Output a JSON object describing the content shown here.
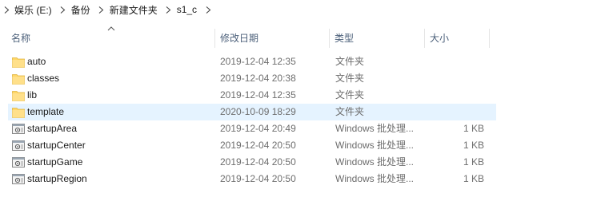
{
  "breadcrumb": [
    "娱乐 (E:)",
    "备份",
    "新建文件夹",
    "s1_c"
  ],
  "columns": {
    "name": "名称",
    "date": "修改日期",
    "type": "类型",
    "size": "大小"
  },
  "sort": {
    "column": "name",
    "direction": "ascending"
  },
  "files": [
    {
      "name": "auto",
      "date": "2019-12-04 12:35",
      "type": "文件夹",
      "size": "",
      "icon": "folder-icon"
    },
    {
      "name": "classes",
      "date": "2019-12-04 20:38",
      "type": "文件夹",
      "size": "",
      "icon": "folder-icon"
    },
    {
      "name": "lib",
      "date": "2019-12-04 12:35",
      "type": "文件夹",
      "size": "",
      "icon": "folder-icon"
    },
    {
      "name": "template",
      "date": "2020-10-09 18:29",
      "type": "文件夹",
      "size": "",
      "icon": "folder-icon",
      "selected": true
    },
    {
      "name": "startupArea",
      "date": "2019-12-04 20:49",
      "type": "Windows 批处理...",
      "size": "1 KB",
      "icon": "batch-file-icon"
    },
    {
      "name": "startupCenter",
      "date": "2019-12-04 20:50",
      "type": "Windows 批处理...",
      "size": "1 KB",
      "icon": "batch-file-icon"
    },
    {
      "name": "startupGame",
      "date": "2019-12-04 20:50",
      "type": "Windows 批处理...",
      "size": "1 KB",
      "icon": "batch-file-icon"
    },
    {
      "name": "startupRegion",
      "date": "2019-12-04 20:50",
      "type": "Windows 批处理...",
      "size": "1 KB",
      "icon": "batch-file-icon"
    }
  ],
  "colors": {
    "header_text": "#4c607a",
    "selected_row": "#e5f3ff",
    "folder_yellow": "#ffd766",
    "muted_text": "#6d6d6d"
  }
}
